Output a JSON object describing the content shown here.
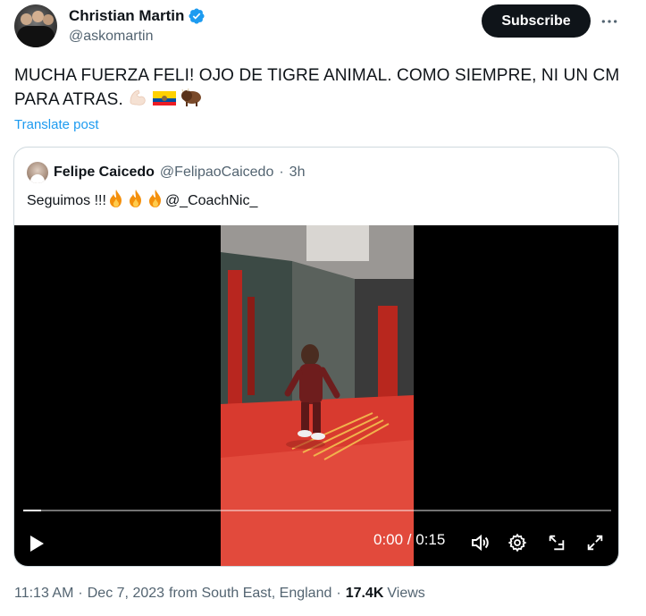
{
  "author": {
    "display_name": "Christian Martin",
    "handle": "@askomartin",
    "verified": true
  },
  "subscribe_label": "Subscribe",
  "tweet": {
    "text": "MUCHA FUERZA FELI! OJO DE TIGRE ANIMAL. COMO SIEMPRE, NI UN CM PARA ATRAS.",
    "emojis": [
      "flexed-biceps-icon",
      "ecuador-flag-icon",
      "bison-icon"
    ],
    "translate_label": "Translate post"
  },
  "quoted": {
    "display_name": "Felipe Caicedo",
    "handle": "@FelipaoCaicedo",
    "separator": "·",
    "age": "3h",
    "text": "Seguimos !!!",
    "emojis": [
      "fire-icon",
      "fire-icon",
      "fire-icon"
    ],
    "mention": "@_CoachNic_"
  },
  "video": {
    "time": "0:00 / 0:15",
    "progress_fraction": 0.03,
    "controls": [
      "play-icon",
      "volume-icon",
      "settings-icon",
      "pop-out-icon",
      "fullscreen-icon"
    ]
  },
  "meta": {
    "time": "11:13 AM",
    "date": "Dec 7, 2023",
    "location": "from South East, England",
    "separator": "·",
    "views_count": "17.4K",
    "views_label": "Views"
  },
  "colors": {
    "link_blue": "#1d9bf0",
    "text": "#0f1419",
    "secondary": "#536471",
    "border": "#cfd9de"
  }
}
